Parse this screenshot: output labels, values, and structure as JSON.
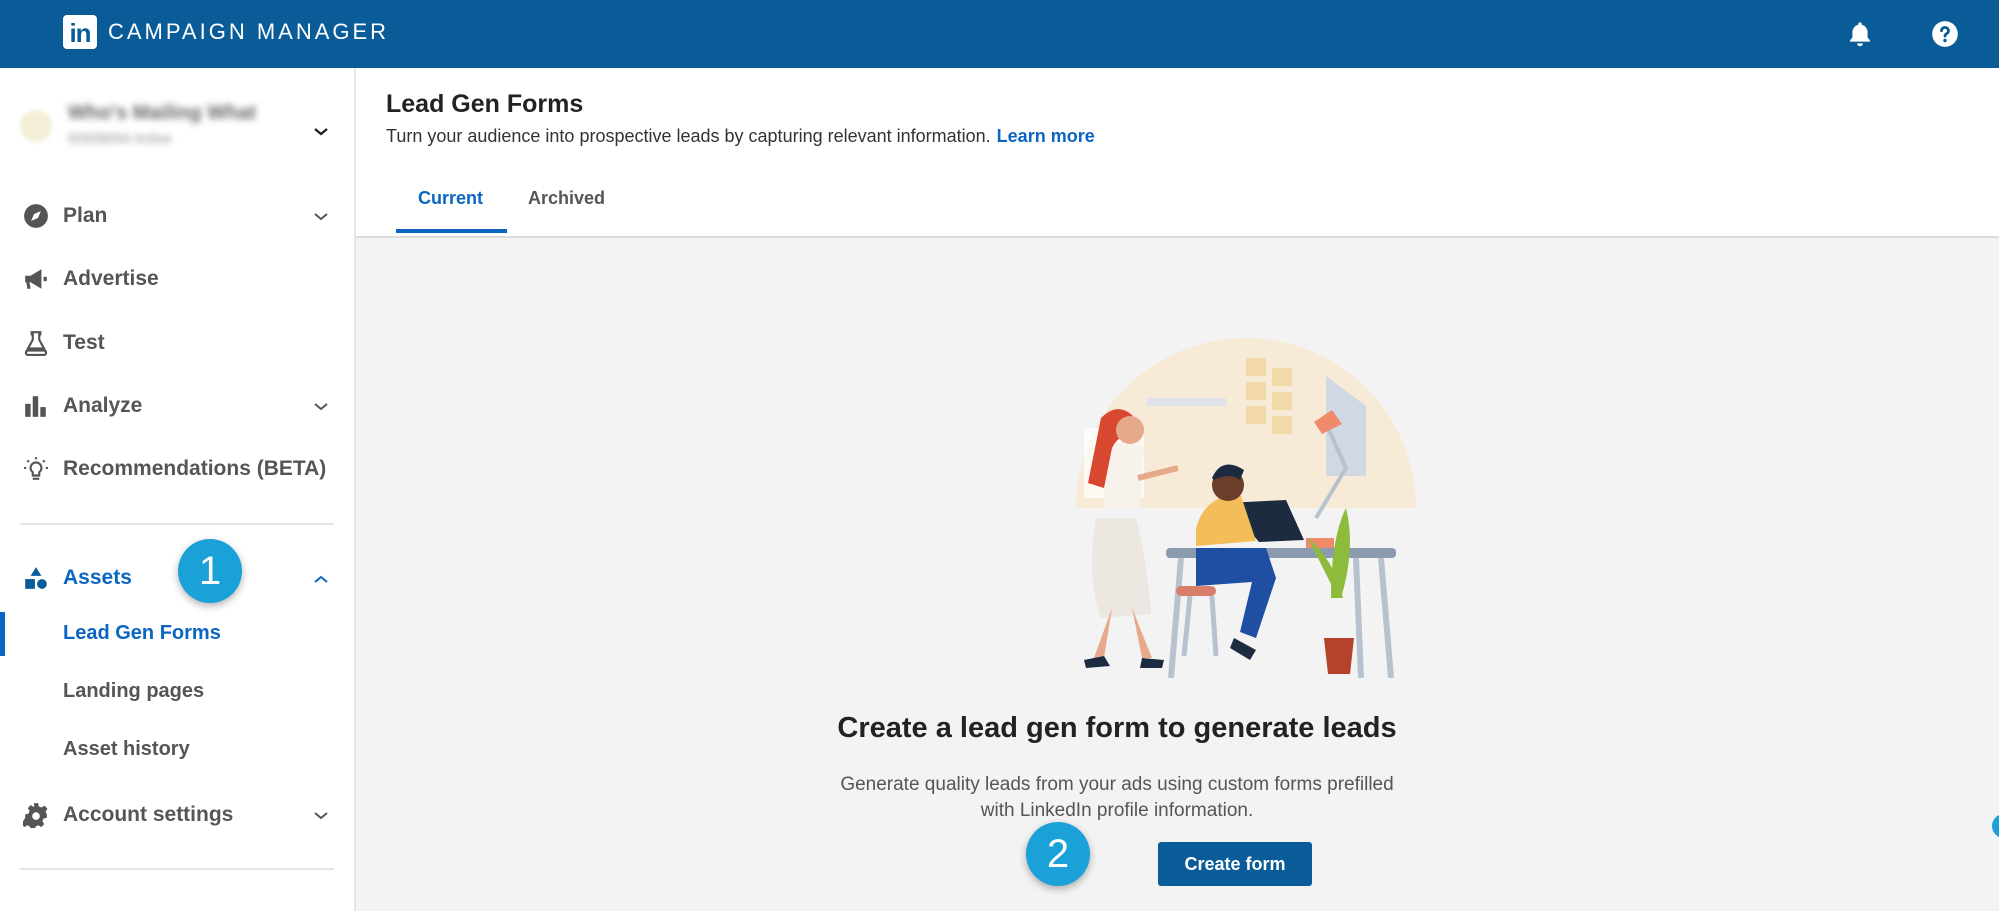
{
  "topbar": {
    "logo_text": "in",
    "brand": "CAMPAIGN MANAGER",
    "icons": [
      "bell-icon",
      "help-icon"
    ]
  },
  "account": {
    "name": "Who's Mailing What",
    "subtitle": "50939054 Active"
  },
  "nav": {
    "plan": "Plan",
    "advertise": "Advertise",
    "test": "Test",
    "analyze": "Analyze",
    "recommendations": "Recommendations (BETA)",
    "assets": "Assets",
    "lead_gen_forms": "Lead Gen Forms",
    "landing_pages": "Landing pages",
    "asset_history": "Asset history",
    "account_settings": "Account settings"
  },
  "badges": {
    "one": "1",
    "two": "2"
  },
  "page": {
    "title": "Lead Gen Forms",
    "subtitle": "Turn your audience into prospective leads by capturing relevant information.",
    "learn_more": "Learn more"
  },
  "tabs": {
    "current": "Current",
    "archived": "Archived"
  },
  "empty_state": {
    "title": "Create a lead gen form to generate leads",
    "description": "Generate quality leads from your ads using custom forms prefilled with LinkedIn profile information.",
    "button": "Create form"
  },
  "colors": {
    "brand": "#0a5c99",
    "accent": "#0a66c2",
    "badge": "#1aa1d8"
  }
}
